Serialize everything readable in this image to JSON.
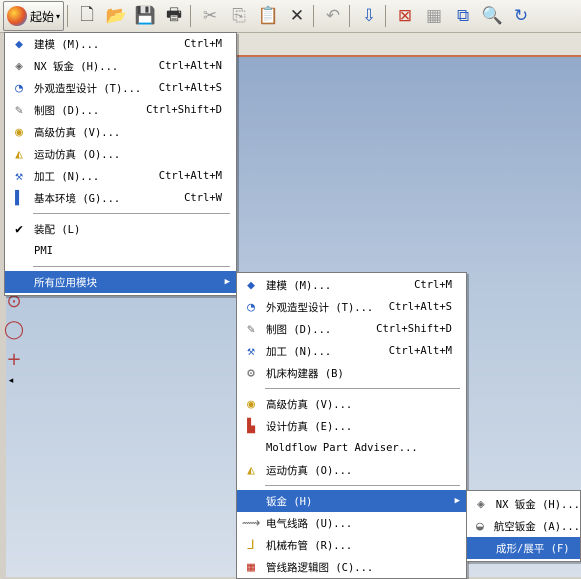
{
  "toolbar": {
    "start_label": "起始",
    "icons": [
      "new-file-icon",
      "open-folder-icon",
      "save-icon",
      "print-icon",
      "cut-icon",
      "copy-icon",
      "paste-icon",
      "delete-icon",
      "undo-icon",
      "selection-icon",
      "fit-view-icon",
      "zoom-window-icon",
      "zoom-area-icon",
      "zoom-icon",
      "rotate-icon"
    ]
  },
  "start_menu": {
    "items": [
      {
        "label": "建模 (M)...",
        "shortcut": "Ctrl+M",
        "icon": "modeling-icon"
      },
      {
        "label": "NX 钣金 (H)...",
        "shortcut": "Ctrl+Alt+N",
        "icon": "nx-sheetmetal-icon"
      },
      {
        "label": "外观造型设计 (T)...",
        "shortcut": "Ctrl+Alt+S",
        "icon": "shape-studio-icon"
      },
      {
        "label": "制图 (D)...",
        "shortcut": "Ctrl+Shift+D",
        "icon": "drafting-icon"
      },
      {
        "label": "高级仿真 (V)...",
        "shortcut": "",
        "icon": "advanced-simulation-icon"
      },
      {
        "label": "运动仿真 (O)...",
        "shortcut": "",
        "icon": "motion-simulation-icon"
      },
      {
        "label": "加工 (N)...",
        "shortcut": "Ctrl+Alt+M",
        "icon": "manufacturing-icon"
      },
      {
        "label": "基本环境 (G)...",
        "shortcut": "Ctrl+W",
        "icon": "gateway-icon"
      },
      {
        "label": "装配 (L)",
        "shortcut": "",
        "icon": "check-icon"
      },
      {
        "label": "PMI",
        "shortcut": "",
        "icon": ""
      },
      {
        "label": "所有应用模块",
        "shortcut": "",
        "icon": ""
      }
    ]
  },
  "all_apps_menu": {
    "items": [
      {
        "label": "建模 (M)...",
        "shortcut": "Ctrl+M"
      },
      {
        "label": "外观造型设计 (T)...",
        "shortcut": "Ctrl+Alt+S"
      },
      {
        "label": "制图 (D)...",
        "shortcut": "Ctrl+Shift+D"
      },
      {
        "label": "加工 (N)...",
        "shortcut": "Ctrl+Alt+M"
      },
      {
        "label": "机床构建器 (B)",
        "shortcut": ""
      },
      {
        "label": "高级仿真 (V)...",
        "shortcut": ""
      },
      {
        "label": "设计仿真 (E)...",
        "shortcut": ""
      },
      {
        "label": "Moldflow Part Adviser...",
        "shortcut": ""
      },
      {
        "label": "运动仿真 (O)...",
        "shortcut": ""
      },
      {
        "label": "钣金 (H)",
        "shortcut": ""
      },
      {
        "label": "电气线路 (U)...",
        "shortcut": ""
      },
      {
        "label": "机械布管 (R)...",
        "shortcut": ""
      },
      {
        "label": "管线路逻辑图 (C)...",
        "shortcut": ""
      }
    ]
  },
  "sheetmetal_menu": {
    "items": [
      {
        "label": "NX 钣金 (H)..."
      },
      {
        "label": "航空钣金 (A)..."
      },
      {
        "label": "成形/展平 (F)"
      }
    ]
  },
  "colors": {
    "selection": "#316ac5",
    "canvas_top": "#8fa6c8",
    "canvas_bottom": "#d6dfea"
  }
}
